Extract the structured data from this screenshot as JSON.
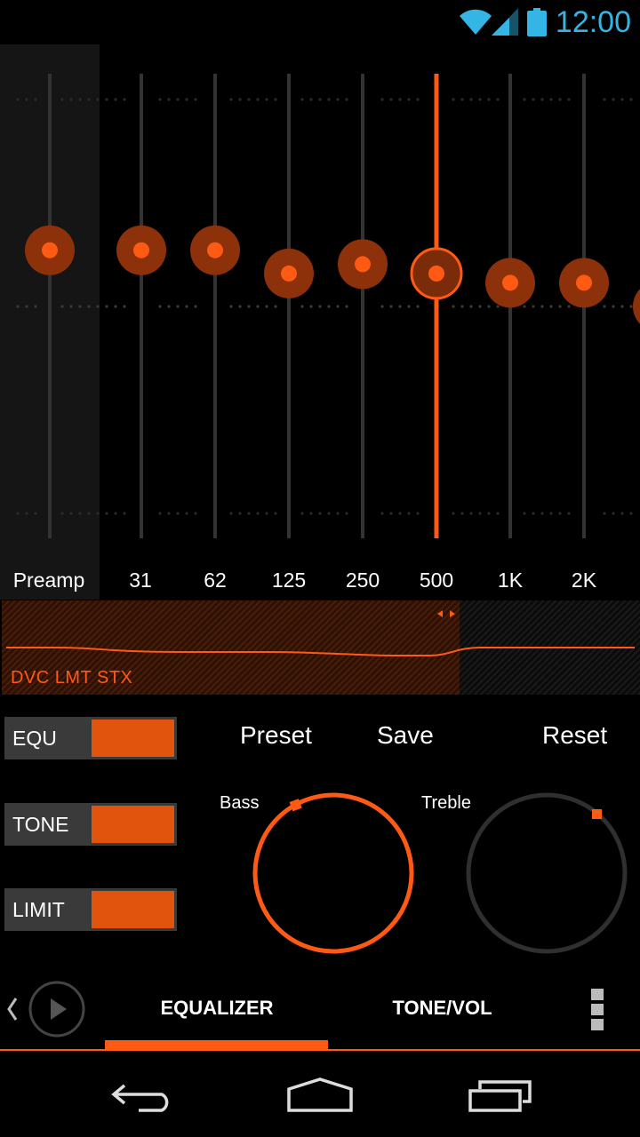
{
  "status_bar": {
    "time": "12:00",
    "icons": [
      "wifi-icon",
      "signal-icon",
      "battery-icon"
    ]
  },
  "eq": {
    "accent_color": "#ff5a14",
    "bands": [
      {
        "label": "Preamp",
        "level": 0.62
      },
      {
        "label": "31",
        "level": 0.62
      },
      {
        "label": "62",
        "level": 0.62
      },
      {
        "label": "125",
        "level": 0.57
      },
      {
        "label": "250",
        "level": 0.59
      },
      {
        "label": "500",
        "level": 0.57,
        "selected": true
      },
      {
        "label": "1K",
        "level": 0.55
      },
      {
        "label": "2K",
        "level": 0.55
      }
    ]
  },
  "spectrum": {
    "status_text": "DVC LMT STX"
  },
  "toggles": [
    {
      "label": "EQU",
      "on": true
    },
    {
      "label": "TONE",
      "on": true
    },
    {
      "label": "LIMIT",
      "on": true
    }
  ],
  "actions": {
    "preset": "Preset",
    "save": "Save",
    "reset": "Reset"
  },
  "knobs": {
    "bass": "Bass",
    "treble": "Treble"
  },
  "tabs": {
    "equalizer": "EQUALIZER",
    "tone_vol": "TONE/VOL",
    "active": "EQUALIZER"
  },
  "nav_icons": [
    "back-icon",
    "home-icon",
    "recent-apps-icon"
  ]
}
